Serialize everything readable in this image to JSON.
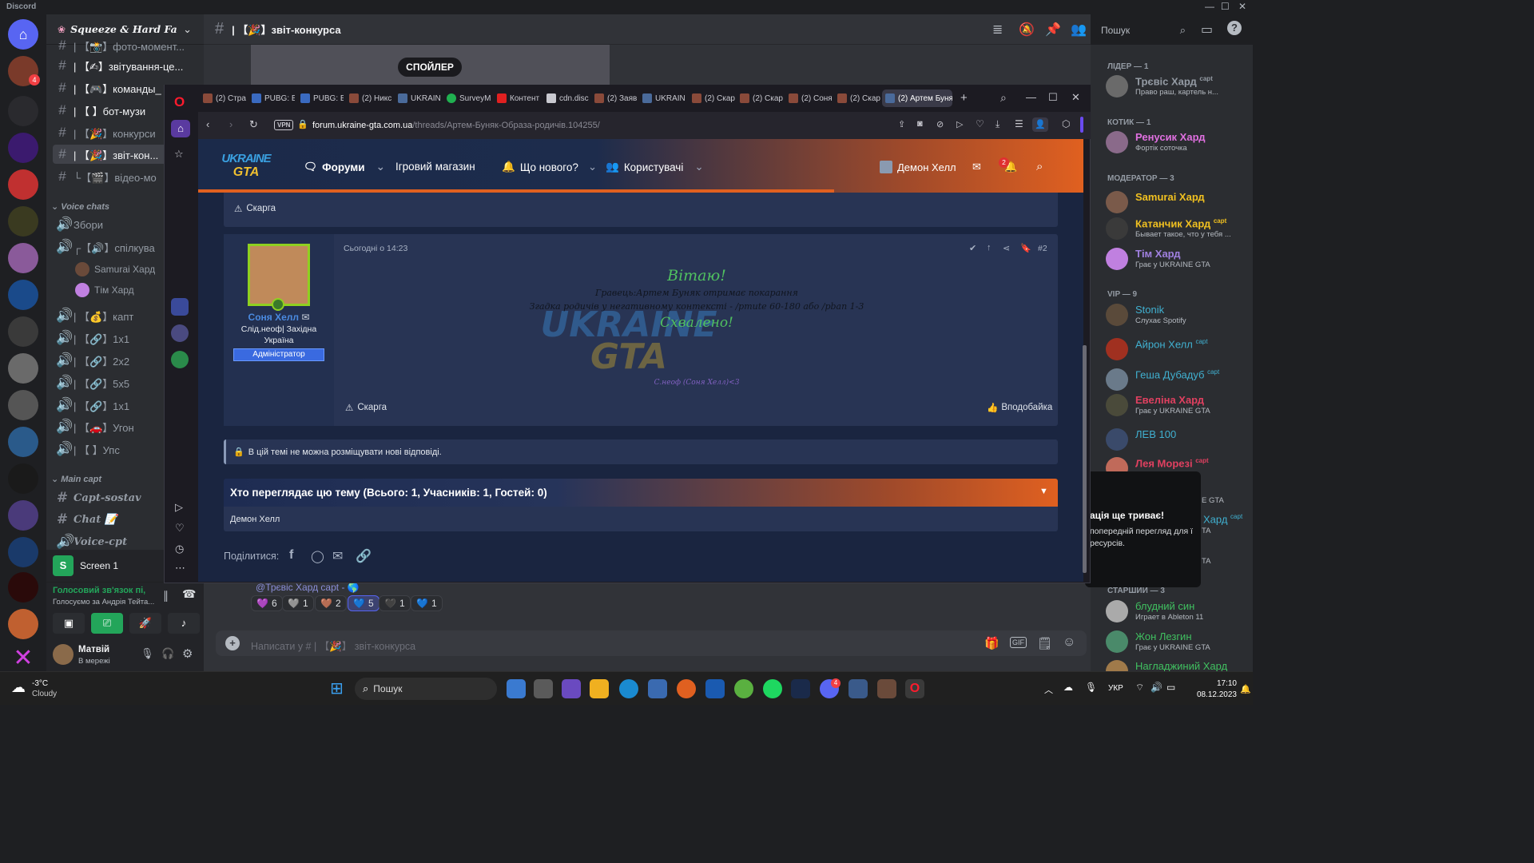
{
  "app": {
    "title": "Discord"
  },
  "server": {
    "name": "Squeeze & Hard Fa"
  },
  "channels": [
    {
      "label": "| 【📸】фото-момент..."
    },
    {
      "label": "| 【✍】звітування-це..."
    },
    {
      "label": "| 【🎮】команды_"
    },
    {
      "label": "| 【 】бот-музи"
    },
    {
      "label": "| 【🎉】конкурси"
    },
    {
      "label": "| 【🎉】звіт-кон..."
    },
    {
      "label": "└【🎬】відео-мо"
    }
  ],
  "voice_category": "Voice chats",
  "voice_channels": [
    {
      "label": "Збори"
    },
    {
      "label": "┌【🔊】спілкува"
    },
    {
      "label": "Samurai Хард"
    },
    {
      "label": "Тім Хард"
    },
    {
      "label": "| 【💰】капт"
    },
    {
      "label": "| 【🔗】1x1"
    },
    {
      "label": "| 【🔗】2x2"
    },
    {
      "label": "| 【🔗】5x5"
    },
    {
      "label": "| 【🔗】1x1"
    },
    {
      "label": "| 【🚗】Угон"
    },
    {
      "label": "| 【 】Упс"
    }
  ],
  "main_category": "Main capt",
  "main_channels": [
    {
      "label": "Capt-sostav"
    },
    {
      "label": "Chat 📝"
    },
    {
      "label": "Voice-cpt"
    }
  ],
  "screen_share": {
    "label": "Screen 1",
    "badge": "S"
  },
  "voice_status": {
    "title": "Голосовий зв'язок пі,",
    "sub": "Голосуємо за Андрія Тейта..."
  },
  "user": {
    "name": "Матвій",
    "status": "В мережі"
  },
  "header": {
    "channel": "| 【🎉】звіт-конкурса",
    "search_placeholder": "Пошук"
  },
  "spoiler_label": "СПОЙЛЕР",
  "members": {
    "groups": [
      {
        "title": "ЛІДЕР — 1"
      },
      {
        "title": "КОТИК — 1"
      },
      {
        "title": "МОДЕРАТОР — 3"
      },
      {
        "title": "VIP — 9"
      },
      {
        "title": "СТАРШИЙ — 3"
      }
    ],
    "list": [
      {
        "name": "Трєвіс Хард",
        "tag": "capt",
        "status": "Право раш, картель н...",
        "color": "#949ba4"
      },
      {
        "name": "Ренусик Хард",
        "tag": "",
        "status": "Фортік соточка",
        "color": "#e070e0"
      },
      {
        "name": "Samurai Хард",
        "tag": "",
        "status": "",
        "color": "#f0c020"
      },
      {
        "name": "Катанчик Хард",
        "tag": "capt",
        "status": "Бывает такое, что у тебя ...",
        "color": "#f0c020"
      },
      {
        "name": "Тім Хард",
        "tag": "",
        "status": "Грає у UKRAINE GTA",
        "color": "#f0c020"
      },
      {
        "name": "Stonik",
        "tag": "",
        "status": "Слухає Spotify",
        "color": "#40b0d0"
      },
      {
        "name": "Айрон Хелл",
        "tag": "capt",
        "status": "",
        "color": "#40b0d0"
      },
      {
        "name": "Геша Дубадуб",
        "tag": "capt",
        "status": "",
        "color": "#40b0d0"
      },
      {
        "name": "Евеліна Хард",
        "tag": "",
        "status": "Грає у UKRAINE GTA",
        "color": "#e04060"
      },
      {
        "name": "ЛЕВ 100",
        "tag": "",
        "status": "",
        "color": "#40b0d0"
      },
      {
        "name": "Лея Морезі",
        "tag": "capt",
        "status": "",
        "color": "#e04060"
      },
      {
        "name": "Хард",
        "tag": "capt",
        "status": "",
        "color": "#40b0d0"
      },
      {
        "name": "блудний син",
        "tag": "",
        "status": "Играет в Ableton 11",
        "color": "#40c060"
      },
      {
        "name": "Жон Лезгин",
        "tag": "",
        "status": "Грає у UKRAINE GTA",
        "color": "#40c060"
      },
      {
        "name": "Нагладжиний Хард",
        "tag": "",
        "status": "",
        "color": "#40c060"
      }
    ]
  },
  "popup": {
    "title": "ація ще триває!",
    "body": "попередній перегляд для ї ресурсів.",
    "side1": "E GTA",
    "side2": "TA",
    "side3": "TA"
  },
  "reactions": [
    {
      "e": "💜",
      "n": "6"
    },
    {
      "e": "🩶",
      "n": "1"
    },
    {
      "e": "🤎",
      "n": "2"
    },
    {
      "e": "💙",
      "n": "5"
    },
    {
      "e": "🖤",
      "n": "1"
    },
    {
      "e": "💙",
      "n": "1"
    }
  ],
  "reply_line": "@Трєвіс Хард capt - 🌎",
  "compose_placeholder": "Написати у # | 【🎉】 звіт-конкурса",
  "browser": {
    "tabs": [
      "(2) Стра",
      "PUBG: B",
      "PUBG: B",
      "(2) Никс",
      "UKRAIN",
      "SurveyM",
      "Контент",
      "cdn.disc",
      "(2) Заяв",
      "UKRAIN",
      "(2) Скар",
      "(2) Скар",
      "(2) Соня",
      "(2) Скар",
      "(2) Артем Буня"
    ],
    "url_host": "forum.ukraine-gta.com.ua",
    "url_path": "/threads/Артем-Буняк-Образа-родичів.104255/",
    "vpn": "VPN"
  },
  "forum": {
    "logo_l1": "UKRAINE",
    "logo_l2": "GTA",
    "nav": [
      "Форуми",
      "Ігровий магазин",
      "Що нового?",
      "Користувачі"
    ],
    "user": "Демон Хелл",
    "notif_count": "2",
    "report": "Скарга",
    "post": {
      "time": "Сьогодні о 14:23",
      "num": "#2",
      "author": "Соня Хелл",
      "role1": "Слід.неоф| Західна",
      "role2": "Україна",
      "badge": "Адміністратор",
      "greet": "Вітаю!",
      "line1": "Гравець:Артем Буняк отримає покарання",
      "line2": "Згадка родичів у негативному контексті - /pmute 60-180 або /pban 1-3",
      "approved": "Схвалено!",
      "sign": "С.неоф (Соня Хелл)<3",
      "like": "Вподобайка"
    },
    "locked": "В цій темі не можна розміщувати нові відповіді.",
    "viewers_title": "Хто переглядає цю тему (Всього: 1, Учасників: 1, Гостей: 0)",
    "viewer": "Демон Хелл",
    "share": "Поділитися:"
  },
  "taskbar": {
    "weather_temp": "-3°C",
    "weather_cond": "Cloudy",
    "search": "Пошук",
    "lang": "УКР",
    "time": "17:10",
    "date": "08.12.2023",
    "discord_badge": "4"
  }
}
